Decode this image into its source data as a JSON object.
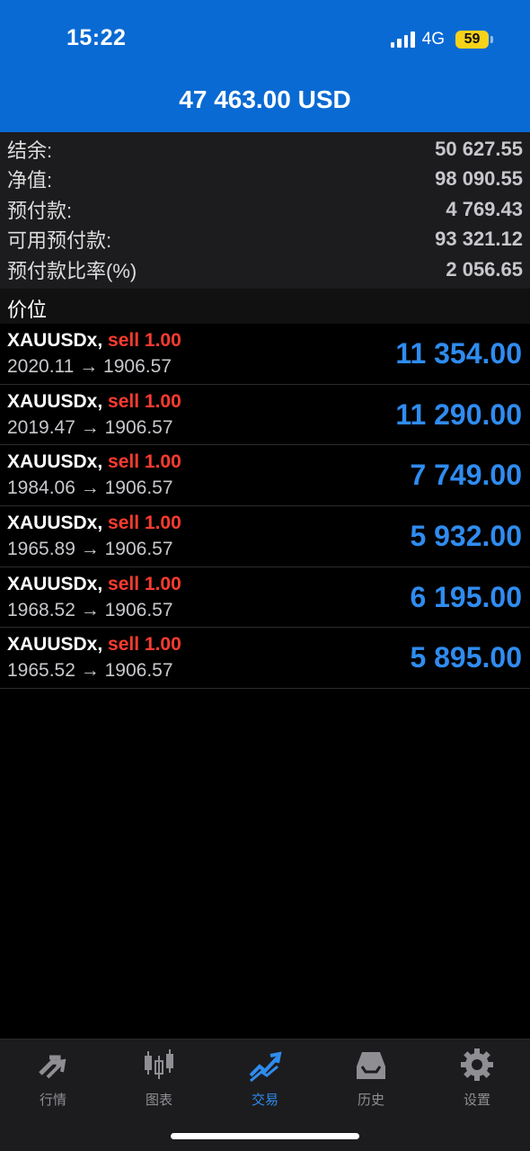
{
  "status_bar": {
    "time": "15:22",
    "network": "4G",
    "battery": "59"
  },
  "header": {
    "title": "47 463.00 USD"
  },
  "summary": [
    {
      "label": "结余:",
      "value": "50 627.55"
    },
    {
      "label": "净值:",
      "value": "98 090.55"
    },
    {
      "label": "预付款:",
      "value": "4 769.43"
    },
    {
      "label": "可用预付款:",
      "value": "93 321.12"
    },
    {
      "label": "预付款比率(%)",
      "value": "2 056.65"
    }
  ],
  "section_title": "价位",
  "positions": [
    {
      "symbol": "XAUUSDx,",
      "side": "sell 1.00",
      "open": "2020.11",
      "arrow": "→",
      "current": "1906.57",
      "profit": "11 354.00"
    },
    {
      "symbol": "XAUUSDx,",
      "side": "sell 1.00",
      "open": "2019.47",
      "arrow": "→",
      "current": "1906.57",
      "profit": "11 290.00"
    },
    {
      "symbol": "XAUUSDx,",
      "side": "sell 1.00",
      "open": "1984.06",
      "arrow": "→",
      "current": "1906.57",
      "profit": "7 749.00"
    },
    {
      "symbol": "XAUUSDx,",
      "side": "sell 1.00",
      "open": "1965.89",
      "arrow": "→",
      "current": "1906.57",
      "profit": "5 932.00"
    },
    {
      "symbol": "XAUUSDx,",
      "side": "sell 1.00",
      "open": "1968.52",
      "arrow": "→",
      "current": "1906.57",
      "profit": "6 195.00"
    },
    {
      "symbol": "XAUUSDx,",
      "side": "sell 1.00",
      "open": "1965.52",
      "arrow": "→",
      "current": "1906.57",
      "profit": "5 895.00"
    }
  ],
  "tabs": [
    {
      "label": "行情",
      "icon": "quotes-arrows-icon"
    },
    {
      "label": "图表",
      "icon": "candlestick-chart-icon"
    },
    {
      "label": "交易",
      "icon": "trade-trend-icon",
      "active": true
    },
    {
      "label": "历史",
      "icon": "history-inbox-icon"
    },
    {
      "label": "设置",
      "icon": "settings-gear-icon"
    }
  ],
  "colors": {
    "header": "#0a6ad3",
    "profit": "#2f8cf0",
    "sell": "#ff3b30",
    "battery": "#f6d21b"
  }
}
